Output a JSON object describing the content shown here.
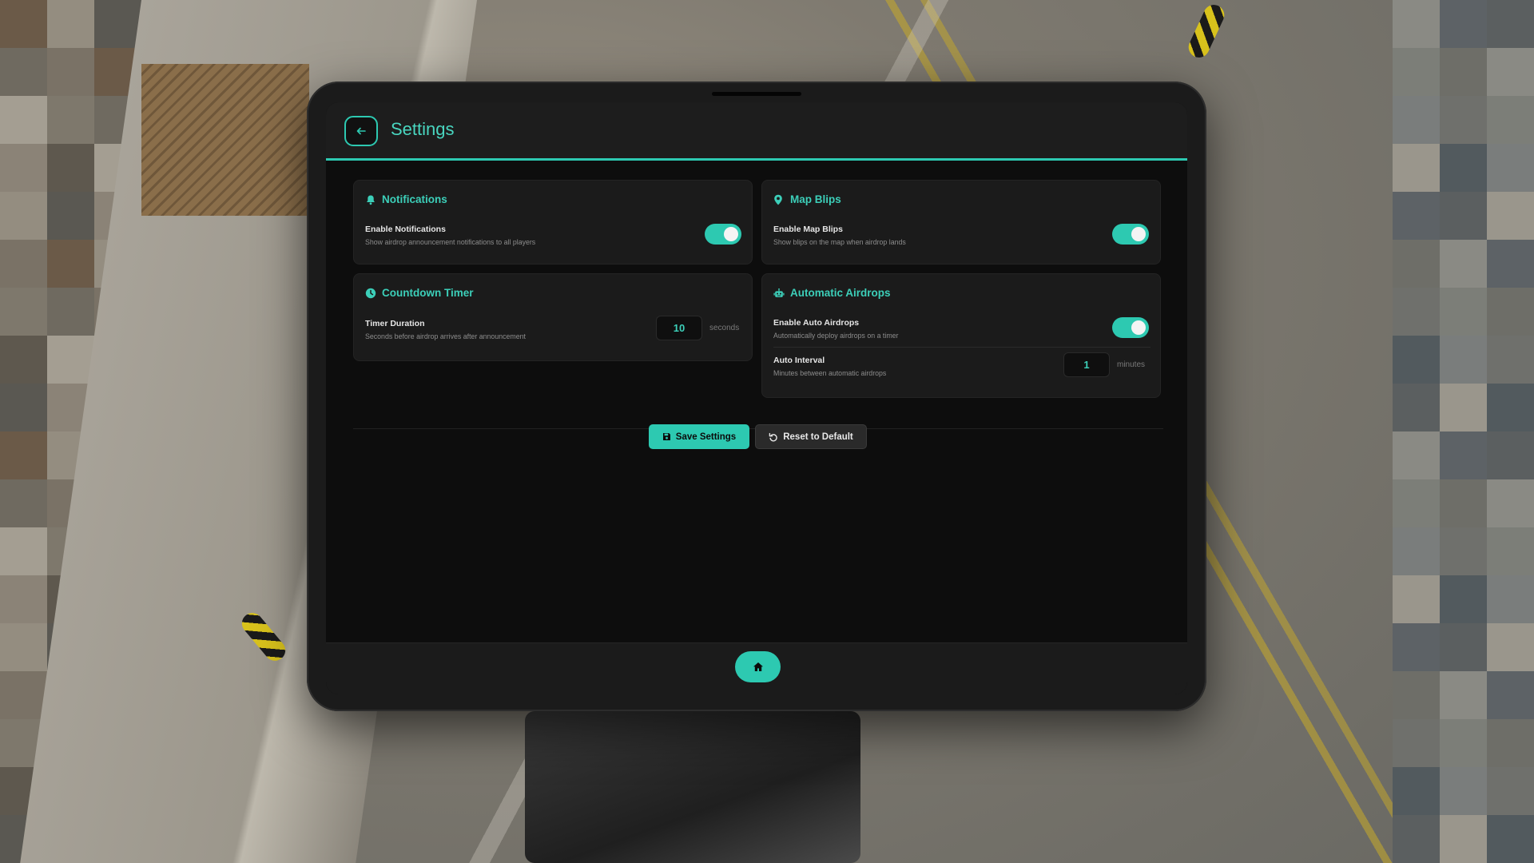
{
  "header": {
    "title": "Settings",
    "back_icon": "arrow-left-icon"
  },
  "notifications": {
    "title": "Notifications",
    "icon": "bell-icon",
    "enable_label": "Enable Notifications",
    "enable_desc": "Show airdrop announcement notifications to all players",
    "enabled": true
  },
  "map_blips": {
    "title": "Map Blips",
    "icon": "map-pin-icon",
    "enable_label": "Enable Map Blips",
    "enable_desc": "Show blips on the map when airdrop lands",
    "enabled": true
  },
  "countdown_timer": {
    "title": "Countdown Timer",
    "icon": "clock-icon",
    "duration_label": "Timer Duration",
    "duration_desc": "Seconds before airdrop arrives after announcement",
    "duration_value": "10",
    "duration_unit": "seconds"
  },
  "automatic_airdrops": {
    "title": "Automatic Airdrops",
    "icon": "robot-icon",
    "enable_label": "Enable Auto Airdrops",
    "enable_desc": "Automatically deploy airdrops on a timer",
    "enabled": true,
    "interval_label": "Auto Interval",
    "interval_desc": "Minutes between automatic airdrops",
    "interval_value": "1",
    "interval_unit": "minutes"
  },
  "actions": {
    "save_label": "Save Settings",
    "save_icon": "floppy-disk-icon",
    "reset_label": "Reset to Default",
    "reset_icon": "undo-icon"
  },
  "footer": {
    "home_icon": "home-icon"
  },
  "colors": {
    "accent": "#2dc9b1",
    "panel": "#1b1b1b",
    "screen_bg": "#0d0d0d"
  }
}
